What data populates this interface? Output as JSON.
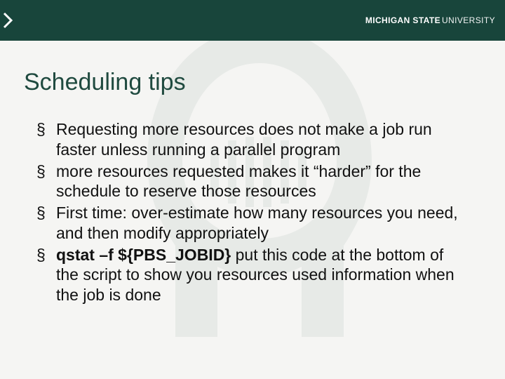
{
  "brand": {
    "bold": "MICHIGAN STATE",
    "light": "UNIVERSITY"
  },
  "title": "Scheduling tips",
  "bullets": [
    {
      "segments": [
        {
          "text": "Requesting more resources does not make a job run faster unless running a parallel program",
          "bold": false
        }
      ]
    },
    {
      "segments": [
        {
          "text": "more resources requested makes it “harder” for the schedule to reserve those resources",
          "bold": false
        }
      ]
    },
    {
      "segments": [
        {
          "text": "First time: over-estimate how many resources you need, and then modify appropriately",
          "bold": false
        }
      ]
    },
    {
      "segments": [
        {
          "text": "qstat –f ${PBS_JOBID} ",
          "bold": true
        },
        {
          "text": "put this code at the bottom of the script to show you resources used information when the job is done",
          "bold": false
        }
      ]
    }
  ],
  "colors": {
    "brand_green": "#18453b",
    "title_green": "#1f4a3f",
    "bg": "#f5f5f3"
  }
}
